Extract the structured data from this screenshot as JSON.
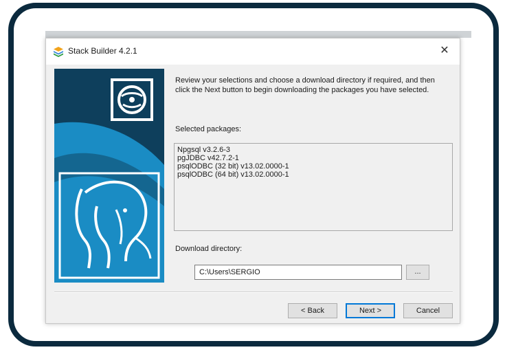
{
  "window": {
    "title": "Stack Builder 4.2.1",
    "close_symbol": "✕"
  },
  "intro_text": "Review your selections and choose a download directory if required, and then click the Next button to begin downloading the packages you have selected.",
  "packages": {
    "label": "Selected packages:",
    "items": [
      "Npgsql v3.2.6-3",
      "pgJDBC v42.7.2-1",
      "psqlODBC (32 bit) v13.02.0000-1",
      "psqlODBC (64 bit) v13.02.0000-1"
    ]
  },
  "download": {
    "label": "Download directory:",
    "value": "C:\\Users\\SERGIO",
    "browse_label": "..."
  },
  "buttons": {
    "back": "< Back",
    "next": "Next >",
    "cancel": "Cancel"
  },
  "colors": {
    "frame": "#0b2a3e",
    "sidebar_dark": "#0e3f5c",
    "sidebar_light": "#1a8cc4",
    "accent": "#0078d7"
  },
  "icons": {
    "app": "stack-builder-icon",
    "disc": "disc-icon",
    "logo": "postgresql-elephant-logo"
  }
}
